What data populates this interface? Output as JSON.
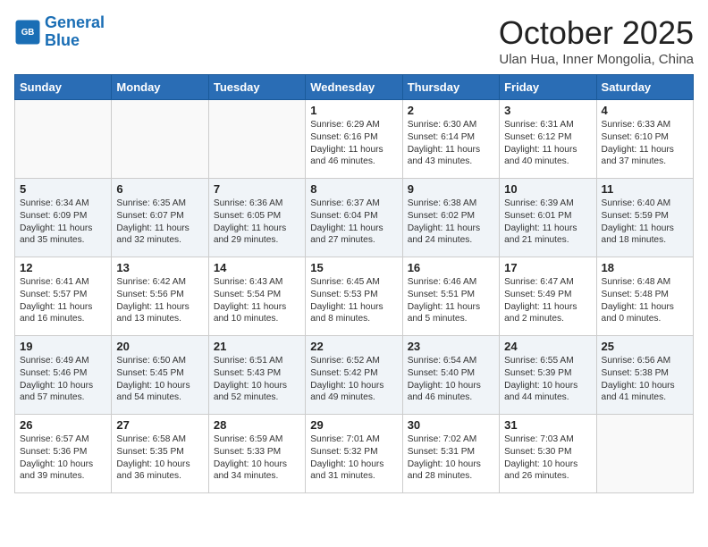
{
  "header": {
    "logo_line1": "General",
    "logo_line2": "Blue",
    "month": "October 2025",
    "location": "Ulan Hua, Inner Mongolia, China"
  },
  "days_of_week": [
    "Sunday",
    "Monday",
    "Tuesday",
    "Wednesday",
    "Thursday",
    "Friday",
    "Saturday"
  ],
  "weeks": [
    [
      {
        "day": "",
        "text": ""
      },
      {
        "day": "",
        "text": ""
      },
      {
        "day": "",
        "text": ""
      },
      {
        "day": "1",
        "text": "Sunrise: 6:29 AM\nSunset: 6:16 PM\nDaylight: 11 hours and 46 minutes."
      },
      {
        "day": "2",
        "text": "Sunrise: 6:30 AM\nSunset: 6:14 PM\nDaylight: 11 hours and 43 minutes."
      },
      {
        "day": "3",
        "text": "Sunrise: 6:31 AM\nSunset: 6:12 PM\nDaylight: 11 hours and 40 minutes."
      },
      {
        "day": "4",
        "text": "Sunrise: 6:33 AM\nSunset: 6:10 PM\nDaylight: 11 hours and 37 minutes."
      }
    ],
    [
      {
        "day": "5",
        "text": "Sunrise: 6:34 AM\nSunset: 6:09 PM\nDaylight: 11 hours and 35 minutes."
      },
      {
        "day": "6",
        "text": "Sunrise: 6:35 AM\nSunset: 6:07 PM\nDaylight: 11 hours and 32 minutes."
      },
      {
        "day": "7",
        "text": "Sunrise: 6:36 AM\nSunset: 6:05 PM\nDaylight: 11 hours and 29 minutes."
      },
      {
        "day": "8",
        "text": "Sunrise: 6:37 AM\nSunset: 6:04 PM\nDaylight: 11 hours and 27 minutes."
      },
      {
        "day": "9",
        "text": "Sunrise: 6:38 AM\nSunset: 6:02 PM\nDaylight: 11 hours and 24 minutes."
      },
      {
        "day": "10",
        "text": "Sunrise: 6:39 AM\nSunset: 6:01 PM\nDaylight: 11 hours and 21 minutes."
      },
      {
        "day": "11",
        "text": "Sunrise: 6:40 AM\nSunset: 5:59 PM\nDaylight: 11 hours and 18 minutes."
      }
    ],
    [
      {
        "day": "12",
        "text": "Sunrise: 6:41 AM\nSunset: 5:57 PM\nDaylight: 11 hours and 16 minutes."
      },
      {
        "day": "13",
        "text": "Sunrise: 6:42 AM\nSunset: 5:56 PM\nDaylight: 11 hours and 13 minutes."
      },
      {
        "day": "14",
        "text": "Sunrise: 6:43 AM\nSunset: 5:54 PM\nDaylight: 11 hours and 10 minutes."
      },
      {
        "day": "15",
        "text": "Sunrise: 6:45 AM\nSunset: 5:53 PM\nDaylight: 11 hours and 8 minutes."
      },
      {
        "day": "16",
        "text": "Sunrise: 6:46 AM\nSunset: 5:51 PM\nDaylight: 11 hours and 5 minutes."
      },
      {
        "day": "17",
        "text": "Sunrise: 6:47 AM\nSunset: 5:49 PM\nDaylight: 11 hours and 2 minutes."
      },
      {
        "day": "18",
        "text": "Sunrise: 6:48 AM\nSunset: 5:48 PM\nDaylight: 11 hours and 0 minutes."
      }
    ],
    [
      {
        "day": "19",
        "text": "Sunrise: 6:49 AM\nSunset: 5:46 PM\nDaylight: 10 hours and 57 minutes."
      },
      {
        "day": "20",
        "text": "Sunrise: 6:50 AM\nSunset: 5:45 PM\nDaylight: 10 hours and 54 minutes."
      },
      {
        "day": "21",
        "text": "Sunrise: 6:51 AM\nSunset: 5:43 PM\nDaylight: 10 hours and 52 minutes."
      },
      {
        "day": "22",
        "text": "Sunrise: 6:52 AM\nSunset: 5:42 PM\nDaylight: 10 hours and 49 minutes."
      },
      {
        "day": "23",
        "text": "Sunrise: 6:54 AM\nSunset: 5:40 PM\nDaylight: 10 hours and 46 minutes."
      },
      {
        "day": "24",
        "text": "Sunrise: 6:55 AM\nSunset: 5:39 PM\nDaylight: 10 hours and 44 minutes."
      },
      {
        "day": "25",
        "text": "Sunrise: 6:56 AM\nSunset: 5:38 PM\nDaylight: 10 hours and 41 minutes."
      }
    ],
    [
      {
        "day": "26",
        "text": "Sunrise: 6:57 AM\nSunset: 5:36 PM\nDaylight: 10 hours and 39 minutes."
      },
      {
        "day": "27",
        "text": "Sunrise: 6:58 AM\nSunset: 5:35 PM\nDaylight: 10 hours and 36 minutes."
      },
      {
        "day": "28",
        "text": "Sunrise: 6:59 AM\nSunset: 5:33 PM\nDaylight: 10 hours and 34 minutes."
      },
      {
        "day": "29",
        "text": "Sunrise: 7:01 AM\nSunset: 5:32 PM\nDaylight: 10 hours and 31 minutes."
      },
      {
        "day": "30",
        "text": "Sunrise: 7:02 AM\nSunset: 5:31 PM\nDaylight: 10 hours and 28 minutes."
      },
      {
        "day": "31",
        "text": "Sunrise: 7:03 AM\nSunset: 5:30 PM\nDaylight: 10 hours and 26 minutes."
      },
      {
        "day": "",
        "text": ""
      }
    ]
  ]
}
